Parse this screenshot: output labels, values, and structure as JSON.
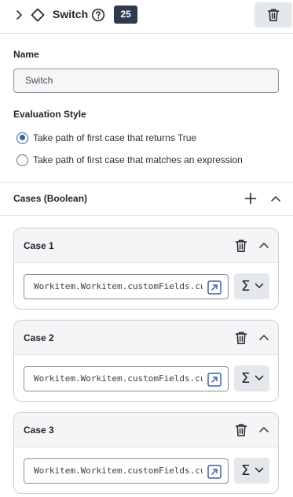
{
  "header": {
    "title": "Switch",
    "badge": "25",
    "icons": [
      "chevron-right-icon",
      "diamond-icon",
      "help-circle-icon",
      "trash-icon"
    ]
  },
  "form": {
    "name_label": "Name",
    "name_value": "Switch",
    "evaluation_label": "Evaluation Style",
    "options": [
      {
        "label": "Take path of first case that returns True",
        "selected": true
      },
      {
        "label": "Take path of first case that matches an expression",
        "selected": false
      }
    ]
  },
  "cases": {
    "title": "Cases (Boolean)",
    "items": [
      {
        "label": "Case 1",
        "expression": "Workitem.Workitem.customFields.cu"
      },
      {
        "label": "Case 2",
        "expression": "Workitem.Workitem.customFields.cu"
      },
      {
        "label": "Case 3",
        "expression": "Workitem.Workitem.customFields.cu"
      }
    ]
  },
  "colors": {
    "badge_bg": "#2f3a4f",
    "accent": "#3d5ea8",
    "button_bg": "#e4e7ec"
  }
}
